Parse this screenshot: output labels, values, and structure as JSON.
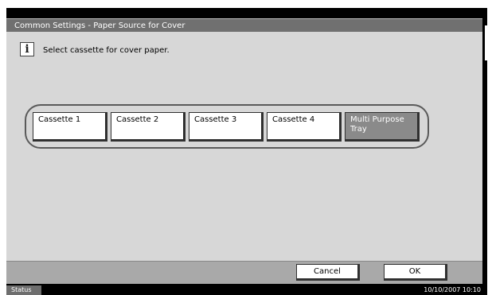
{
  "window": {
    "title": "Common Settings - Paper Source for Cover"
  },
  "message": {
    "icon": "info-icon",
    "text": "Select cassette for cover paper."
  },
  "sources": [
    {
      "label": "Cassette 1",
      "selected": false
    },
    {
      "label": "Cassette 2",
      "selected": false
    },
    {
      "label": "Cassette 3",
      "selected": false
    },
    {
      "label": "Cassette 4",
      "selected": false
    },
    {
      "label": "Multi Purpose\nTray",
      "selected": true
    }
  ],
  "actions": {
    "cancel_label": "Cancel",
    "ok_label": "OK"
  },
  "status": {
    "label": "Status",
    "datetime": "10/10/2007   10:10"
  },
  "colors": {
    "panel": "#d7d7d7",
    "selected": "#8a8a8a",
    "titlebar": "#707070"
  }
}
